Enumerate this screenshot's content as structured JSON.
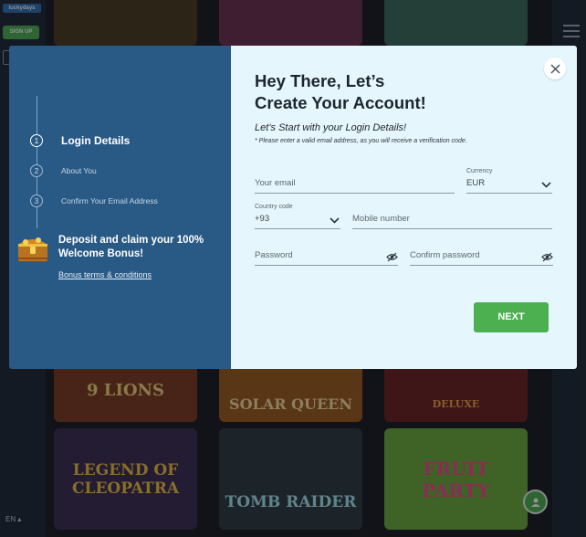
{
  "background": {
    "logo_text": "luckydays",
    "signup_label": "SIGN UP",
    "language": "EN",
    "tiles": [
      {
        "label": "",
        "bg": "#3c5a2a"
      },
      {
        "label": "",
        "bg": "#6a2f4e"
      },
      {
        "label": "",
        "bg": "#2d4f6a"
      },
      {
        "label": "9 LIONS",
        "bg": "#7a3a1f"
      },
      {
        "label": "SOLAR QUEEN",
        "bg": "#8a5a1a"
      },
      {
        "label": "DELUXE",
        "bg": "#5a1f1f"
      },
      {
        "label": "LEGEND OF CLEOPATRA",
        "bg": "#3a2a50"
      },
      {
        "label": "TOMB RAIDER",
        "bg": "#2a3a40"
      },
      {
        "label": "FRUIT PARTY",
        "bg": "#5a9a3a"
      }
    ]
  },
  "modal": {
    "steps": [
      {
        "number": "1",
        "label": "Login Details"
      },
      {
        "number": "2",
        "label": "About You"
      },
      {
        "number": "3",
        "label": "Confirm Your Email Address"
      }
    ],
    "promo_text": "Deposit and claim your 100% Welcome Bonus!",
    "terms_link": "Bonus terms & conditions",
    "title_line1": "Hey There, Let’s",
    "title_line2": "Create Your Account!",
    "subtitle": "Let’s Start with your Login Details!",
    "note": "* Please enter a valid email address, as you will receive a verification code.",
    "email_placeholder": "Your email",
    "currency_label": "Currency",
    "currency_value": "EUR",
    "country_code_label": "Country code",
    "country_code_value": "+93",
    "mobile_placeholder": "Mobile number",
    "password_placeholder": "Password",
    "confirm_password_placeholder": "Confirm password",
    "next_label": "NEXT"
  },
  "colors": {
    "left_panel": "#295a86",
    "right_panel": "#e6f6fd",
    "accent_green": "#4caf50"
  }
}
